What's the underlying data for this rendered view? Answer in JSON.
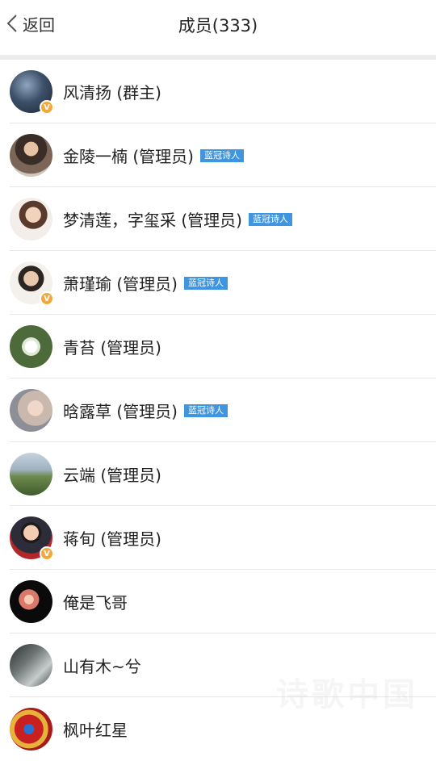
{
  "header": {
    "back_label": "返回",
    "title": "成员(333)"
  },
  "members": [
    {
      "name": "风清扬 (群主)",
      "tag": "",
      "badge": true
    },
    {
      "name": "金陵一楠 (管理员)",
      "tag": "蓝冠诗人",
      "badge": false
    },
    {
      "name": "梦清莲，字玺采 (管理员)",
      "tag": "蓝冠诗人",
      "badge": false
    },
    {
      "name": "萧瑾瑜 (管理员)",
      "tag": "蓝冠诗人",
      "badge": true
    },
    {
      "name": "青苔 (管理员)",
      "tag": "",
      "badge": false
    },
    {
      "name": "晗露草 (管理员)",
      "tag": "蓝冠诗人",
      "badge": false
    },
    {
      "name": "云端 (管理员)",
      "tag": "",
      "badge": false
    },
    {
      "name": "蒋旬 (管理员)",
      "tag": "",
      "badge": true
    },
    {
      "name": "俺是飞哥",
      "tag": "",
      "badge": false
    },
    {
      "name": "山有木~兮",
      "tag": "",
      "badge": false
    },
    {
      "name": "枫叶红星",
      "tag": "",
      "badge": false
    }
  ],
  "watermark": "诗歌中国",
  "colors": {
    "tag_bg": "#3f95e0",
    "badge": "#f2a93b"
  }
}
